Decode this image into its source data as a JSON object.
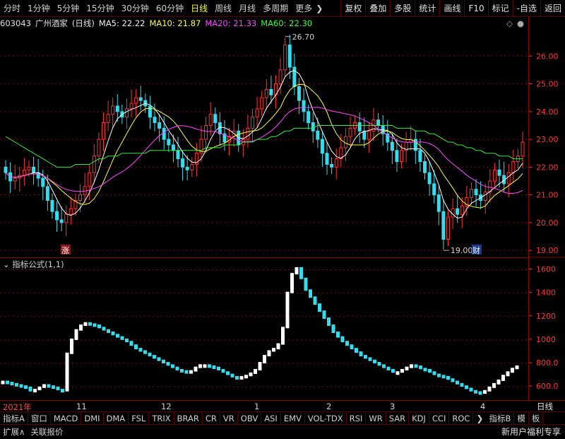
{
  "toolbar": {
    "periods": [
      "分时",
      "1分钟",
      "5分钟",
      "15分钟",
      "30分钟",
      "60分钟",
      "日线",
      "周线",
      "月线",
      "多周期",
      "更多"
    ],
    "active_period": "日线",
    "more_icon": "chevron-right-icon",
    "buttons": [
      "复权",
      "叠加",
      "多股",
      "统计",
      "画线",
      "F10",
      "标记",
      "-自选",
      "返回"
    ]
  },
  "info": {
    "code": "603043",
    "name": "广州酒家",
    "period": "(日线)",
    "ma5": "MA5: 22.22",
    "ma10": "MA10: 21.87",
    "ma20": "MA20: 21.33",
    "ma60": "MA60: 22.30"
  },
  "colors": {
    "up": "#ff3333",
    "down": "#33ddee",
    "ma5": "#ffffff",
    "ma10": "#ffff33",
    "ma20": "#ff44ff",
    "ma60": "#33ee33",
    "axis": "#ff3333",
    "grid": "#8b0000"
  },
  "price_axis": {
    "ticks": [
      "26.00",
      "25.00",
      "24.00",
      "23.00",
      "22.00",
      "21.00",
      "20.00",
      "19.00"
    ]
  },
  "indicator_axis": {
    "ticks": [
      "1600",
      "1400",
      "1200",
      "1000",
      "800.0",
      "600.0"
    ]
  },
  "annotations": {
    "high": "26.70",
    "low": "19.00",
    "mark_rise": "涨",
    "mark_fin": "财"
  },
  "indicator": {
    "title": "指标公式(1,1)"
  },
  "dates": {
    "labels": [
      "2021年",
      "11",
      "12",
      "1",
      "2",
      "3",
      "4"
    ],
    "period_label": "日线"
  },
  "tabs": [
    "指标A",
    "窗口",
    "MACD",
    "DMI",
    "DMA",
    "FSL",
    "TRIX",
    "BRAR",
    "CR",
    "VR",
    "OBV",
    "ASI",
    "EMV",
    "VOL-TDX",
    "RSI",
    "WR",
    "SAR",
    "KDJ",
    "CCI",
    "ROC"
  ],
  "tabs_right": [
    "指标B",
    "模",
    "板"
  ],
  "bottom": {
    "left": [
      "扩展∧",
      "关联报价"
    ],
    "right": "新用户福利专享"
  },
  "chart_data": {
    "type": "candlestick",
    "price": {
      "close": [
        21.8,
        21.5,
        21.6,
        21.7,
        21.9,
        22.0,
        21.8,
        21.6,
        21.3,
        20.8,
        20.4,
        20.1,
        20.0,
        20.3,
        20.5,
        20.8,
        21.0,
        21.3,
        21.8,
        22.4,
        23.0,
        23.6,
        23.9,
        24.2,
        24.0,
        23.8,
        24.1,
        24.3,
        24.5,
        24.4,
        24.2,
        23.8,
        23.6,
        23.4,
        23.0,
        22.8,
        22.6,
        22.3,
        22.0,
        21.9,
        22.1,
        22.5,
        23.0,
        23.5,
        23.9,
        23.6,
        23.2,
        22.9,
        23.1,
        23.3,
        22.8,
        23.0,
        23.4,
        23.8,
        24.1,
        24.5,
        24.8,
        24.6,
        25.0,
        25.5,
        26.4,
        25.6,
        24.9,
        24.4,
        24.0,
        23.6,
        23.3,
        23.0,
        22.5,
        22.1,
        22.0,
        22.3,
        22.7,
        23.1,
        23.4,
        23.6,
        23.3,
        23.0,
        23.3,
        23.7,
        23.5,
        23.2,
        22.9,
        22.6,
        22.2,
        22.6,
        22.9,
        23.0,
        22.6,
        22.2,
        21.8,
        21.4,
        21.0,
        20.4,
        19.4,
        20.2,
        20.5,
        20.3,
        20.6,
        20.9,
        21.2,
        21.0,
        20.8,
        21.1,
        21.5,
        21.9,
        21.7,
        21.4,
        21.8,
        22.2,
        22.4,
        22.9
      ],
      "ma60": [
        23.1,
        23.0,
        22.9,
        22.8,
        22.7,
        22.6,
        22.5,
        22.4,
        22.3,
        22.2,
        22.1,
        22.0,
        22.0,
        22.0,
        22.0,
        22.1,
        22.1,
        22.1,
        22.1,
        22.2,
        22.3,
        22.3,
        22.4,
        22.4,
        22.4,
        22.5,
        22.5,
        22.5,
        22.5,
        22.5,
        22.5,
        22.6,
        22.6,
        22.6,
        22.6,
        22.6,
        22.6,
        22.6,
        22.6,
        22.6,
        22.6,
        22.6,
        22.6,
        22.7,
        22.7,
        22.7,
        22.7,
        22.8,
        22.8,
        22.8,
        22.8,
        22.9,
        22.9,
        22.9,
        23.0,
        23.0,
        23.0,
        23.1,
        23.1,
        23.2,
        23.3,
        23.3,
        23.4,
        23.4,
        23.4,
        23.4,
        23.4,
        23.5,
        23.5,
        23.5,
        23.5,
        23.5,
        23.5,
        23.5,
        23.5,
        23.5,
        23.5,
        23.5,
        23.5,
        23.5,
        23.5,
        23.5,
        23.5,
        23.5,
        23.4,
        23.4,
        23.4,
        23.4,
        23.3,
        23.3,
        23.3,
        23.2,
        23.2,
        23.1,
        23.0,
        22.9,
        22.9,
        22.8,
        22.8,
        22.7,
        22.7,
        22.6,
        22.6,
        22.5,
        22.5,
        22.5,
        22.4,
        22.4,
        22.4,
        22.3,
        22.3,
        22.3
      ],
      "high": 26.7,
      "low": 19.0
    },
    "indicator": {
      "values": [
        640,
        630,
        620,
        610,
        600,
        590,
        560,
        570,
        590,
        610,
        600,
        590,
        570,
        560,
        880,
        1000,
        1080,
        1120,
        1140,
        1130,
        1120,
        1100,
        1080,
        1060,
        1040,
        1020,
        1000,
        980,
        950,
        920,
        900,
        880,
        860,
        840,
        820,
        800,
        780,
        760,
        740,
        730,
        720,
        730,
        760,
        780,
        780,
        770,
        760,
        740,
        720,
        700,
        680,
        670,
        680,
        690,
        710,
        740,
        800,
        860,
        900,
        920,
        960,
        1100,
        1400,
        1560,
        1610,
        1520,
        1420,
        1360,
        1300,
        1240,
        1180,
        1120,
        1060,
        1020,
        980,
        950,
        920,
        890,
        860,
        840,
        820,
        800,
        780,
        760,
        740,
        720,
        720,
        740,
        760,
        780,
        770,
        750,
        740,
        720,
        700,
        690,
        680,
        660,
        640,
        620,
        600,
        580,
        560,
        550,
        540,
        560,
        590,
        620,
        650,
        690,
        720,
        750,
        770
      ],
      "ylim": [
        480,
        1700
      ]
    }
  }
}
